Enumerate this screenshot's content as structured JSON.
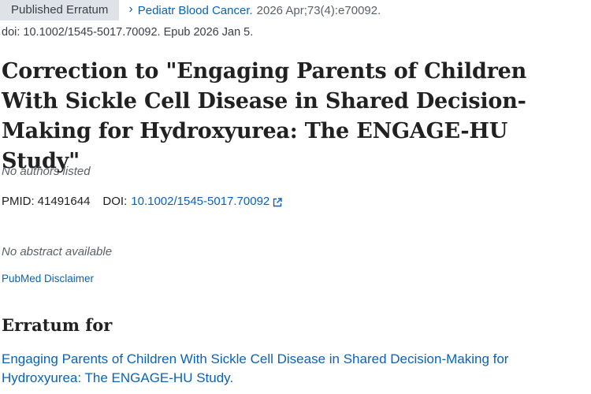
{
  "header": {
    "badge": "Published Erratum",
    "journal": "Pediatr Blood Cancer.",
    "citation": "2026 Apr;73(4):e70092.",
    "doi_line": "doi: 10.1002/1545-5017.70092. Epub 2026 Jan 5."
  },
  "article": {
    "title": "Correction to \"Engaging Parents of Children With Sickle Cell Disease in Shared Decision-Making for Hydroxyurea: The ENGAGE-HU Study\"",
    "authors": "No authors listed",
    "pmid_label": "PMID:",
    "pmid": "41491644",
    "doi_label": "DOI:",
    "doi": "10.1002/1545-5017.70092",
    "abstract": "No abstract available",
    "disclaimer": "PubMed Disclaimer"
  },
  "erratum": {
    "heading": "Erratum for",
    "link": "Engaging Parents of Children With Sickle Cell Disease in Shared Decision-Making for Hydroxyurea: The ENGAGE-HU Study."
  },
  "icons": {
    "chevron": "chevron-right-icon",
    "external": "external-link-icon"
  },
  "colors": {
    "link": "#0b63b5",
    "badge_bg": "#dfe3e8",
    "muted": "#5b6168"
  }
}
